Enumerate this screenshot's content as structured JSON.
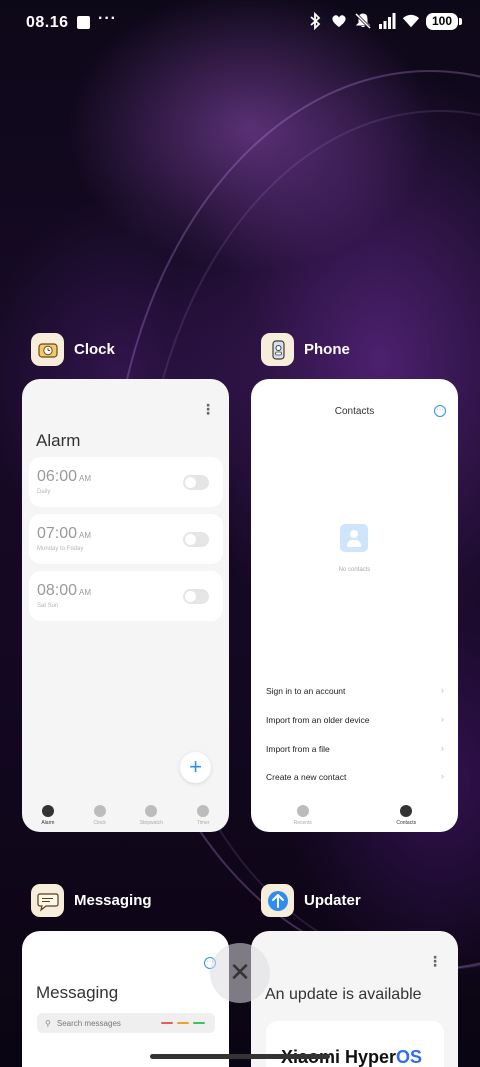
{
  "status_bar": {
    "time": "08.16",
    "more": "···",
    "battery": "100",
    "icons": [
      "notification-square-icon",
      "more-icon",
      "bluetooth-icon",
      "heart-icon",
      "mute-icon",
      "signal-icon",
      "wifi-icon",
      "battery-icon"
    ]
  },
  "apps": [
    {
      "name": "Clock",
      "icon": "clock-app-icon",
      "screen": {
        "title": "Alarm",
        "alarms": [
          {
            "time": "06:00",
            "ampm": "AM",
            "desc": "Daily"
          },
          {
            "time": "07:00",
            "ampm": "AM",
            "desc": "Monday to Friday"
          },
          {
            "time": "08:00",
            "ampm": "AM",
            "desc": "Sat Sun"
          }
        ],
        "fab": "+",
        "nav": [
          "Alarm",
          "Clock",
          "Stopwatch",
          "Timer"
        ]
      }
    },
    {
      "name": "Phone",
      "icon": "phone-app-icon",
      "screen": {
        "title": "Contacts",
        "empty_text": "No contacts",
        "options": [
          "Sign in to an account",
          "Import from an older device",
          "Import from a file",
          "Create a new contact"
        ],
        "nav": [
          "Recents",
          "Contacts"
        ]
      }
    },
    {
      "name": "Messaging",
      "icon": "messaging-app-icon",
      "screen": {
        "title": "Messaging",
        "search_placeholder": "Search messages",
        "dash_colors": [
          "#e85d5d",
          "#f0a030",
          "#3cc45a"
        ]
      }
    },
    {
      "name": "Updater",
      "icon": "updater-app-icon",
      "screen": {
        "title": "An update is available",
        "logo_brand": "Xiaomi Hyper",
        "logo_os": "OS"
      }
    }
  ],
  "close_button": "✕",
  "accent_color": "#2f8cf0"
}
